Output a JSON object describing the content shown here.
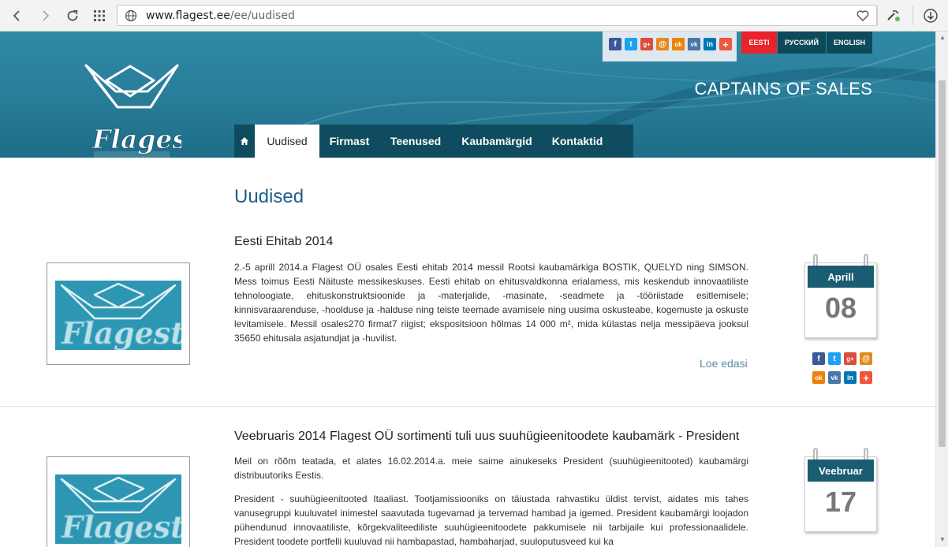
{
  "browser": {
    "url_domain": "www.flagest.ee",
    "url_path": "/ee/uudised"
  },
  "header": {
    "tagline": "CAPTAINS OF SALES",
    "logo_text": "Flagest",
    "languages": [
      "EESTI",
      "РУССКИЙ",
      "ENGLISH"
    ],
    "active_language": "EESTI"
  },
  "nav": {
    "home_icon": "home-icon",
    "items": [
      "Uudised",
      "Firmast",
      "Teenused",
      "Kaubamärgid",
      "Kontaktid"
    ],
    "active": "Uudised"
  },
  "page_title": "Uudised",
  "articles": [
    {
      "title": "Eesti Ehitab 2014",
      "paragraphs": [
        "2.-5 aprill 2014.a Flagest OÜ osales Eesti ehitab 2014 messil Rootsi kaubamärkiga BOSTIK, QUELYD ning SIMSON. Mess toimus Eesti Näituste messikeskuses. Eesti ehitab on ehitusvaldkonna erialamess, mis keskendub innovaatiliste tehnoloogiate, ehituskonstruktsioonide ja -materjalide, -masinate, -seadmete ja -tööriistade esitlemisele; kinnisvaraarenduse, -hoolduse ja -halduse ning teiste teemade avamisele ning uusima oskusteabe, kogemuste ja oskuste levitamisele. Messil osales270 firmat7 riigist; ekspositsioon hõlmas 14 000 m², mida külastas nelja messipäeva jooksul 35650 ehitusala asjatundjat ja -huvilist."
      ],
      "read_more": "Loe edasi",
      "date_month": "Aprill",
      "date_day": "08"
    },
    {
      "title": "Veebruaris 2014 Flagest OÜ sortimenti tuli uus suuhügieenitoodete kaubamärk - President",
      "paragraphs": [
        "Meil on rõõm teatada, et alates 16.02.2014.a. meie saime ainukeseks President (suuhügieenitooted) kaubamärgi distribuutoriks Eestis.",
        "President - suuhügieenitooted Itaaliast. Tootjamissiooniks on täiustada rahvastiku üldist tervist, aidates mis tahes vanusegruppi kuuluvatel inimestel saavutada tugevamad ja tervemad hambad ja igemed. President kaubamärgi loojadon pühendunud innovaatiliste, kõrgekvaliteediliste suuhügieenitoodete pakkumisele nii tarbijaile kui professionaalidele. President toodete portfelli kuuluvad nii hambapastad, hambaharjad, suuloputusveed kui ka"
      ],
      "date_month": "Veebruar",
      "date_day": "17"
    }
  ],
  "social_icons": [
    {
      "name": "facebook-icon",
      "glyph": "f",
      "color": "#3b5998"
    },
    {
      "name": "twitter-icon",
      "glyph": "t",
      "color": "#1da1f2"
    },
    {
      "name": "google-plus-icon",
      "glyph": "g+",
      "color": "#dd4b39"
    },
    {
      "name": "mail-icon",
      "glyph": "@",
      "color": "#e38a1f"
    },
    {
      "name": "odnoklassniki-icon",
      "glyph": "ok",
      "color": "#ee8208"
    },
    {
      "name": "vk-icon",
      "glyph": "vk",
      "color": "#4a76a8"
    },
    {
      "name": "linkedin-icon",
      "glyph": "in",
      "color": "#0077b5"
    },
    {
      "name": "more-icon",
      "glyph": "+",
      "color": "#f0553d"
    }
  ]
}
